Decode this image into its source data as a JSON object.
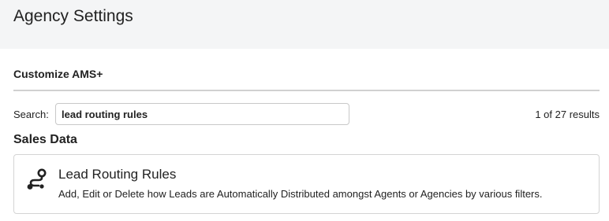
{
  "header": {
    "title": "Agency Settings"
  },
  "section": {
    "heading": "Customize AMS+"
  },
  "search": {
    "label": "Search:",
    "value": "lead routing rules",
    "results": "1 of 27 results"
  },
  "groups": [
    {
      "heading": "Sales Data",
      "items": [
        {
          "icon": "route-icon",
          "title": "Lead Routing Rules",
          "description": "Add, Edit or Delete how Leads are Automatically Distributed amongst Agents or Agencies by various filters."
        }
      ]
    }
  ]
}
